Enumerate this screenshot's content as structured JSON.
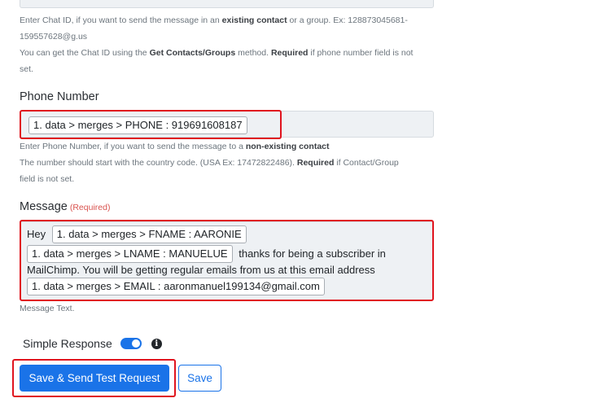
{
  "chat_id": {
    "help_line1_prefix": "Enter Chat ID, if you want to send the message in an ",
    "help_line1_bold": "existing contact",
    "help_line1_suffix": " or a group. Ex: 128873045681-",
    "help_line2": "159557628@g.us",
    "help_line3_prefix": "You can get the Chat ID using the ",
    "help_line3_bold1": "Get Contacts/Groups",
    "help_line3_mid": " method. ",
    "help_line3_bold2": "Required",
    "help_line3_suffix": " if phone number field is not",
    "help_line4": "set."
  },
  "phone": {
    "label": "Phone Number",
    "value_pill": "1. data > merges > PHONE : 919691608187",
    "help_line1_prefix": "Enter Phone Number, if you want to send the message to a ",
    "help_line1_bold": "non-existing contact",
    "help_line2_prefix": "The number should start with the country code. (USA Ex: 17472822486). ",
    "help_line2_bold": "Required",
    "help_line2_suffix": " if Contact/Group",
    "help_line3": "field is not set."
  },
  "message": {
    "label": "Message",
    "required": "(Required)",
    "text_hey": "Hey",
    "pill_fname": "1. data > merges > FNAME : AARONIE",
    "pill_lname": "1. data > merges > LNAME : MANUELUE",
    "text_after_lname": "thanks for being a subscriber in",
    "text_line3": "MailChimp. You will be getting regular emails from us at this email address",
    "pill_email": "1. data > merges > EMAIL : aaronmanuel199134@gmail.com",
    "help": "Message Text."
  },
  "simple_response": {
    "label": "Simple Response",
    "enabled": true,
    "info_icon": "info-circle-icon"
  },
  "buttons": {
    "save_send": "Save & Send Test Request",
    "save": "Save"
  },
  "colors": {
    "primary": "#1a73e8",
    "highlight": "#e0141e",
    "required": "#d9534f"
  }
}
